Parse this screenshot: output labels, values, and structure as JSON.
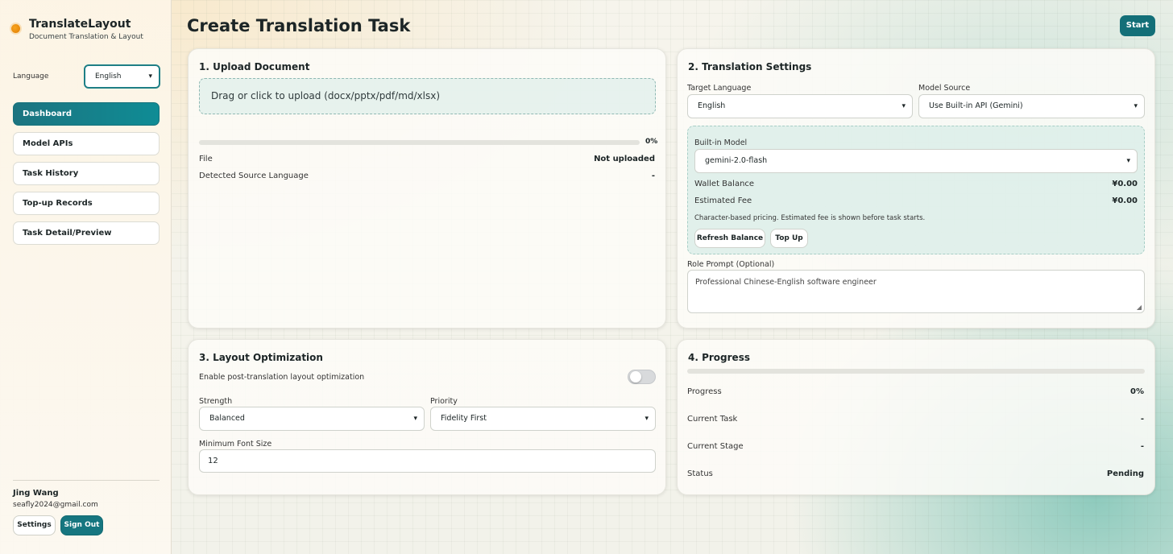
{
  "brand": {
    "title": "TranslateLayout",
    "subtitle": "Document Translation & Layout",
    "accent": "#136f78"
  },
  "sidebar": {
    "language_label": "Language",
    "language_value": "English",
    "nav": [
      {
        "label": "Dashboard",
        "active": true
      },
      {
        "label": "Model APIs"
      },
      {
        "label": "Task History"
      },
      {
        "label": "Top-up Records"
      },
      {
        "label": "Task Detail/Preview"
      }
    ],
    "user": {
      "name": "Jing Wang",
      "email": "seafly2024@gmail.com"
    },
    "settings_label": "Settings",
    "signout_label": "Sign Out"
  },
  "page": {
    "title": "Create Translation Task",
    "start_label": "Start"
  },
  "upload": {
    "title": "1. Upload Document",
    "dropzone": "Drag or click to upload (docx/pptx/pdf/md/xlsx)",
    "progress_percent": "0%",
    "file_label": "File",
    "file_value": "Not uploaded",
    "source_label": "Detected Source Language",
    "source_value": "-"
  },
  "settings": {
    "title": "2. Translation Settings",
    "target_label": "Target Language",
    "target_value": "English",
    "source_label": "Model Source",
    "source_value": "Use Built-in API (Gemini)",
    "builtin_label": "Built-in Model",
    "builtin_value": "gemini-2.0-flash",
    "wallet_label": "Wallet Balance",
    "wallet_value": "¥0.00",
    "fee_label": "Estimated Fee",
    "fee_value": "¥0.00",
    "note": "Character-based pricing. Estimated fee is shown before task starts.",
    "refresh_label": "Refresh Balance",
    "topup_label": "Top Up",
    "prompt_label": "Role Prompt (Optional)",
    "prompt_placeholder": "Professional Chinese-English software engineer"
  },
  "layout": {
    "title": "3. Layout Optimization",
    "enable_label": "Enable post-translation layout optimization",
    "enabled": false,
    "strength_label": "Strength",
    "strength_value": "Balanced",
    "priority_label": "Priority",
    "priority_value": "Fidelity First",
    "minfont_label": "Minimum Font Size",
    "minfont_value": "12"
  },
  "progress": {
    "title": "4. Progress",
    "progress_label": "Progress",
    "progress_value": "0%",
    "task_label": "Current Task",
    "task_value": "-",
    "stage_label": "Current Stage",
    "stage_value": "-",
    "status_label": "Status",
    "status_value": "Pending"
  }
}
